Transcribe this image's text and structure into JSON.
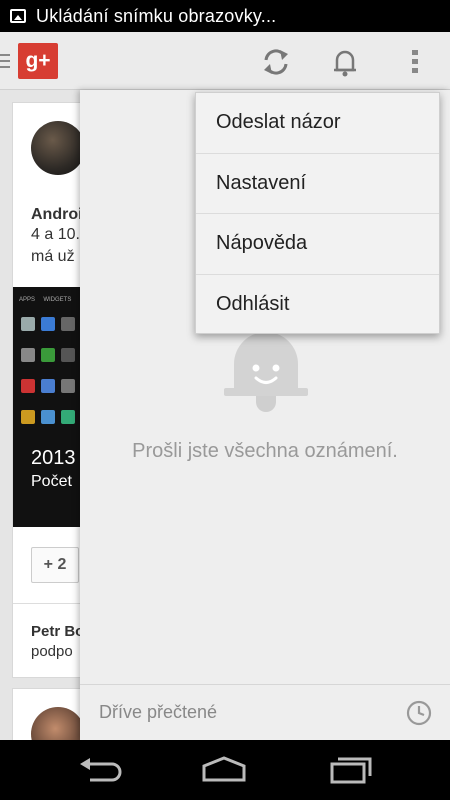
{
  "status_bar": {
    "notification_text": "Ukládání snímku obrazovky..."
  },
  "action_bar": {
    "logo_text": "g+"
  },
  "stream": {
    "post1": {
      "author_partial": "Androi",
      "line1": "4 a 10.",
      "line2": "má už",
      "thumb_year": "2013",
      "thumb_count": "Počet",
      "plus_label": "+ 2",
      "commenter": "Petr Bo",
      "comment_text": "podpo"
    }
  },
  "overflow_menu": {
    "items": [
      {
        "label": "Odeslat názor"
      },
      {
        "label": "Nastavení"
      },
      {
        "label": "Nápověda"
      },
      {
        "label": "Odhlásit"
      }
    ]
  },
  "notifications": {
    "empty_message": "Prošli jste všechna oznámení.",
    "footer_label": "Dříve přečtené"
  },
  "colors": {
    "gplus_red": "#d73d32",
    "panel_bg": "#eeeeee",
    "menu_bg": "#f2f2f2"
  },
  "icons": [
    "image-icon",
    "hamburger-icon",
    "refresh-icon",
    "bell-icon",
    "overflow-icon",
    "clock-icon",
    "back-icon",
    "home-icon",
    "recents-icon"
  ]
}
